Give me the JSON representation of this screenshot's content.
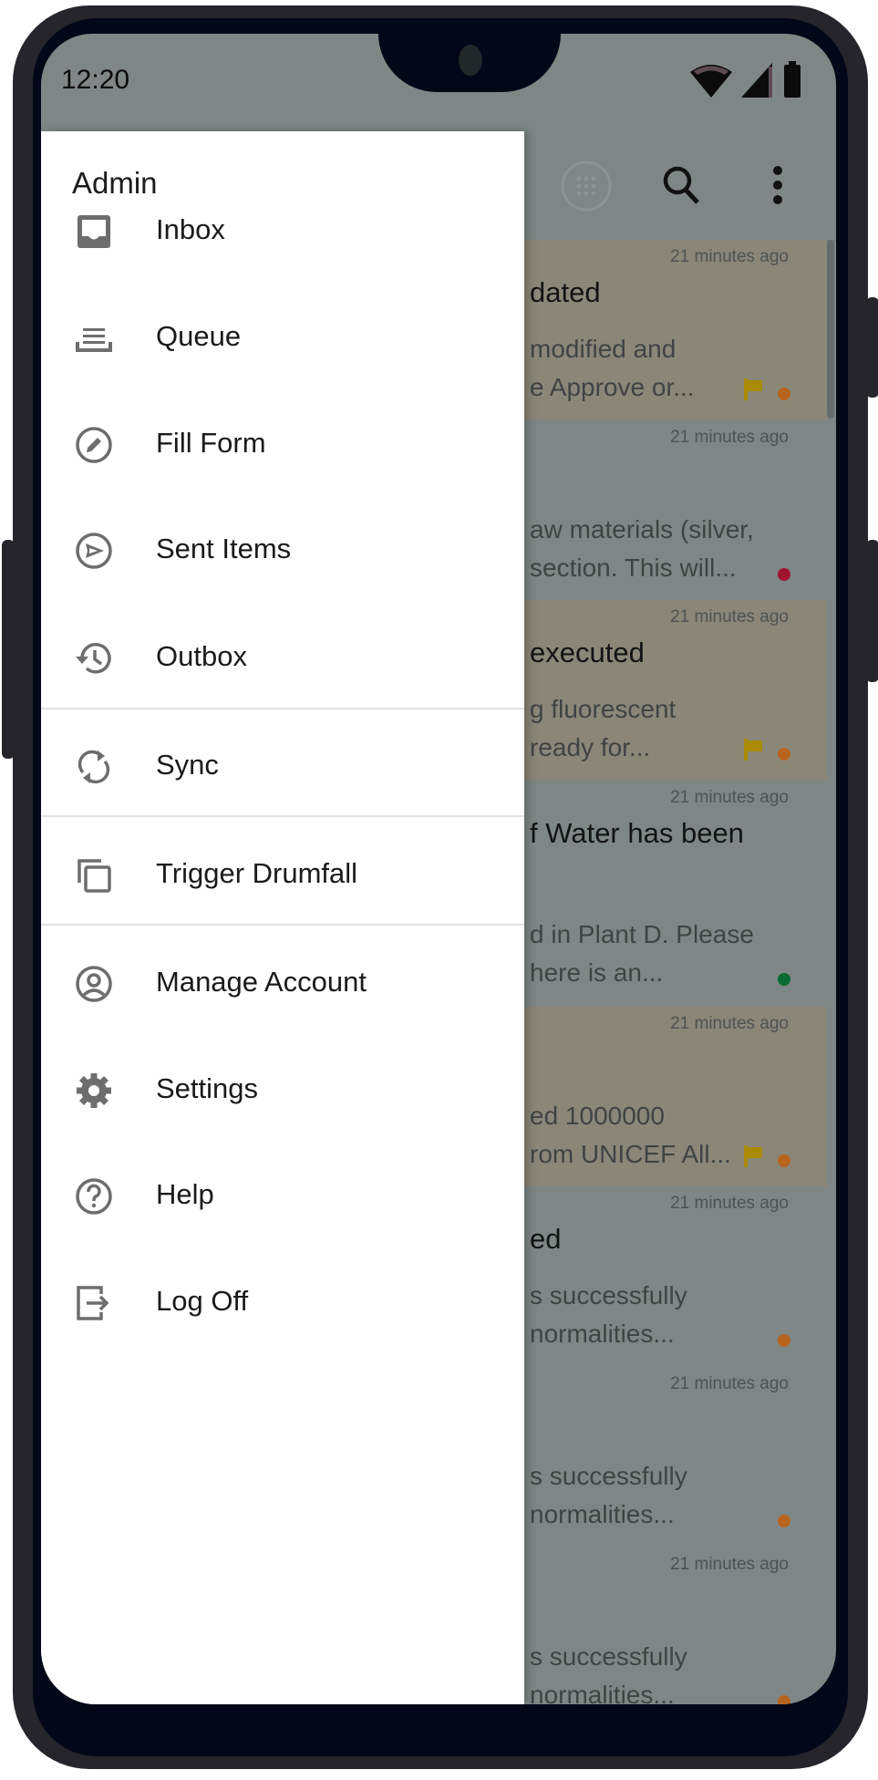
{
  "status_bar": {
    "time": "12:20"
  },
  "drawer": {
    "title": "Admin",
    "items": [
      {
        "label": "Inbox",
        "icon": "inbox-icon"
      },
      {
        "label": "Queue",
        "icon": "queue-icon"
      },
      {
        "label": "Fill Form",
        "icon": "edit-circle-icon"
      },
      {
        "label": "Sent Items",
        "icon": "send-circle-icon"
      },
      {
        "label": "Outbox",
        "icon": "history-icon"
      },
      {
        "label": "Sync",
        "icon": "sync-icon"
      },
      {
        "label": "Trigger Drumfall",
        "icon": "copy-icon"
      },
      {
        "label": "Manage Account",
        "icon": "account-circle-icon"
      },
      {
        "label": "Settings",
        "icon": "gear-icon"
      },
      {
        "label": "Help",
        "icon": "help-circle-icon"
      },
      {
        "label": "Log Off",
        "icon": "logout-icon"
      }
    ]
  },
  "colors": {
    "flag": "#a98a00",
    "orange": "#b8641e",
    "red": "#a11330",
    "green": "#0b6b31"
  },
  "cards": [
    {
      "time": "21 minutes ago",
      "title": "dated",
      "line1": "modified and",
      "line2": "e Approve or...",
      "flag": true,
      "dot": "#b8641e",
      "highlight": true
    },
    {
      "time": "21 minutes ago",
      "title": "",
      "line1": "aw materials (silver,",
      "line2": "section. This will...",
      "flag": false,
      "dot": "#a11330",
      "highlight": false
    },
    {
      "time": "21 minutes ago",
      "title": "executed",
      "line1": "g fluorescent",
      "line2": "ready for...",
      "flag": true,
      "dot": "#b8641e",
      "highlight": true
    },
    {
      "time": "21 minutes ago",
      "title": "f Water has been",
      "line1": "d in Plant D. Please",
      "line2": "here is an...",
      "flag": false,
      "dot": "#0b6b31",
      "highlight": false
    },
    {
      "time": "21 minutes ago",
      "title": "",
      "line1": "ed 1000000",
      "line2": "rom UNICEF All...",
      "flag": true,
      "dot": "#b8641e",
      "highlight": true
    },
    {
      "time": "21 minutes ago",
      "title": "ed",
      "line1": "s successfully",
      "line2": "normalities...",
      "flag": false,
      "dot": "#b8641e",
      "highlight": false
    },
    {
      "time": "21 minutes ago",
      "title": "",
      "line1": "s successfully",
      "line2": "normalities...",
      "flag": false,
      "dot": "#b8641e",
      "highlight": false
    },
    {
      "time": "21 minutes ago",
      "title": "",
      "line1": "s successfully",
      "line2": "normalities...",
      "flag": false,
      "dot": "#b8641e",
      "highlight": false
    }
  ]
}
